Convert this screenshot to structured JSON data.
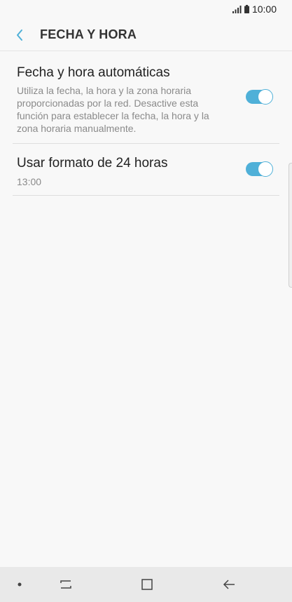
{
  "status_bar": {
    "time": "10:00",
    "icons": [
      "signal-icon",
      "battery-icon"
    ]
  },
  "header": {
    "title": "FECHA Y HORA",
    "back_icon": "chevron-left-icon",
    "accent_color": "#4fb0d8"
  },
  "settings": {
    "auto_datetime": {
      "title": "Fecha y hora automáticas",
      "description": "Utiliza la fecha, la hora y la zona horaria proporcionadas por la red. Desactive esta función para establecer la fecha, la hora y la zona horaria manualmente.",
      "enabled": true
    },
    "format_24h": {
      "title": "Usar formato de 24 horas",
      "subtitle": "13:00",
      "enabled": true
    }
  },
  "nav_bar": {
    "buttons": [
      "dot-icon",
      "recent-apps-icon",
      "home-icon",
      "back-arrow-icon"
    ]
  }
}
